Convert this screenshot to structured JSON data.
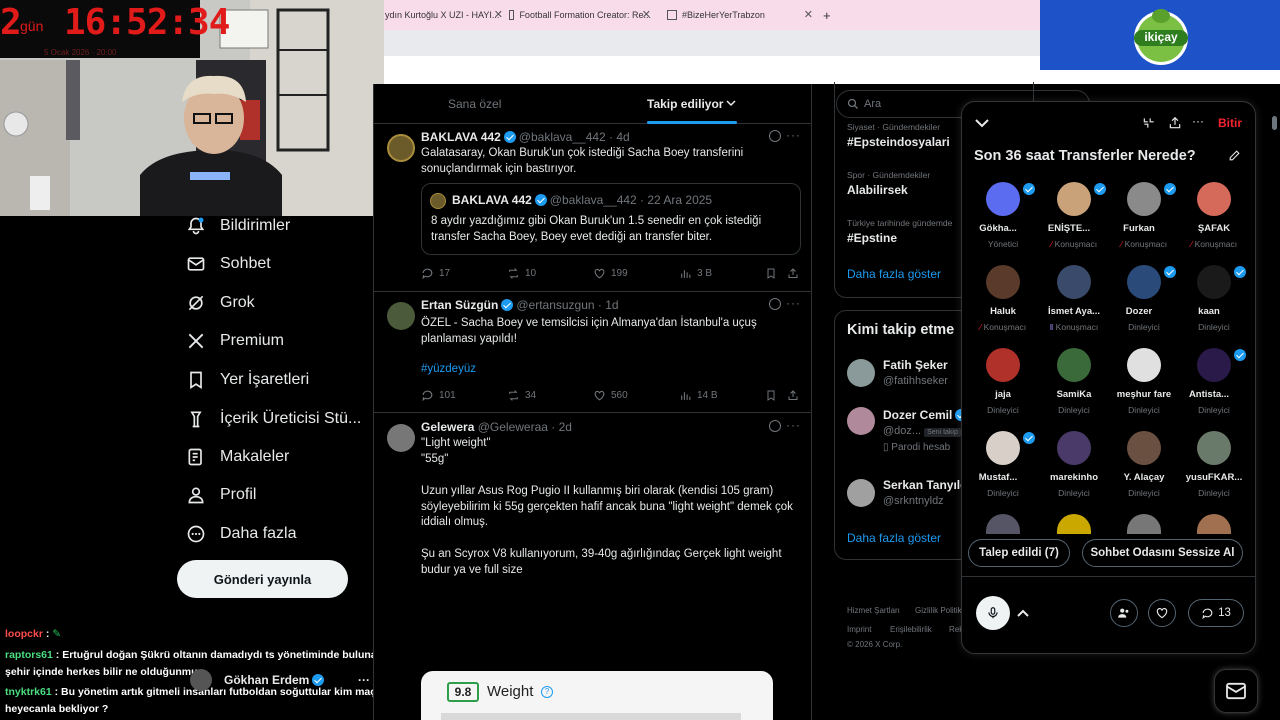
{
  "clock": {
    "days": "2",
    "days_label": "gün",
    "time": "16:52:34",
    "date": "5 Ocak 2026 · 20:00"
  },
  "browser": {
    "tabs": [
      {
        "title": "ydın Kurtoğlu X UZI - HAYI..."
      },
      {
        "title": "Football Formation Creator: Re..."
      },
      {
        "title": "#BizeHerYerTrabzon"
      }
    ],
    "new_tab": "+"
  },
  "logo": {
    "text": "ikiçay"
  },
  "nav": {
    "items": [
      {
        "label": "Bildirimler",
        "icon": "bell-icon"
      },
      {
        "label": "Sohbet",
        "icon": "mail-icon"
      },
      {
        "label": "Grok",
        "icon": "grok-icon"
      },
      {
        "label": "Premium",
        "icon": "x-logo-icon"
      },
      {
        "label": "Yer İşaretleri",
        "icon": "bookmark-icon"
      },
      {
        "label": "İçerik Üreticisi Stü...",
        "icon": "creator-icon"
      },
      {
        "label": "Makaleler",
        "icon": "article-icon"
      },
      {
        "label": "Profil",
        "icon": "profile-icon"
      },
      {
        "label": "Daha fazla",
        "icon": "more-icon"
      }
    ],
    "post_button": "Gönderi yayınla"
  },
  "chat": {
    "lines": [
      {
        "user": "loopckr",
        "user_color": "#ff4d4d",
        "text": ":"
      },
      {
        "user": "raptors61",
        "user_color": "#4ade80",
        "text": ": Ertuğrul doğan Şükrü oltanın damadıydı ts yönetiminde bulunana kadar"
      },
      {
        "user": "",
        "user_color": "#ffffff",
        "text": "şehir içinde herkes bilir ne olduğunmu"
      },
      {
        "user": "tnyktrk61",
        "user_color": "#4ade80",
        "text": ": Bu yönetim artık gitmeli insanları futboldan soğuttular kim maçı"
      },
      {
        "user": "",
        "user_color": "#ffffff",
        "text": "heyecanla bekliyor ?"
      }
    ],
    "account_chip": {
      "name": "Gökhan Erdem"
    }
  },
  "timeline": {
    "tabs": [
      {
        "label": "Sana özel"
      },
      {
        "label": "Takip ediliyor"
      }
    ],
    "tweets": [
      {
        "name": "BAKLAVA 442",
        "handle": "@baklava__442 · 4d",
        "text": "Galatasaray, Okan Buruk'un çok istediği Sacha Boey transferini sonuçlandırmak için bastırıyor.",
        "quote": {
          "name": "BAKLAVA 442",
          "handle": "@baklava__442 · 22 Ara 2025",
          "text": "8 aydır yazdığımız gibi Okan Buruk'un 1.5 senedir en çok istediği transfer Sacha Boey, Boey evet dediği an transfer biter."
        },
        "replies": "17",
        "reposts": "10",
        "likes": "199",
        "views": "3 B"
      },
      {
        "name": "Ertan Süzgün",
        "handle": "@ertansuzgun · 1d",
        "text": "ÖZEL - Sacha Boey ve temsilcisi için Almanya'dan İstanbul'a uçuş planlaması yapıldı!",
        "hashtag": "#yüzdeyüz",
        "replies": "101",
        "reposts": "34",
        "likes": "560",
        "views": "14 B"
      },
      {
        "name": "Gelewera",
        "handle": "@Geleweraa · 2d",
        "lines": [
          "\"Light weight\"",
          "\"55g\"",
          "Uzun yıllar Asus Rog Pugio II kullanmış biri olarak (kendisi 105 gram) söyleyebilirim ki 55g gerçekten hafif ancak buna \"light weight\" demek çok iddialı olmuş.",
          "Şu an Scyrox V8 kullanıyorum, 39-40g ağırlığındaç Gerçek light weight budur ya ve full size"
        ],
        "media": {
          "score": "9.8",
          "label": "Weight"
        }
      }
    ]
  },
  "right": {
    "search_placeholder": "Ara",
    "trends": [
      {
        "category": "Siyaset · Gündemdekiler",
        "name": "#Epsteindosyalari"
      },
      {
        "category": "Spor · Gündemdekiler",
        "name": "Alabilirsek"
      },
      {
        "category": "Türkiye tarihinde gündemde",
        "name": "#Epstine"
      }
    ],
    "trends_more": "Daha fazla göster",
    "who_to_follow_title": "Kimi takip etme",
    "follow": [
      {
        "name": "Fatih Şeker",
        "handle": "@fatihhseker"
      },
      {
        "name": "Dozer Cemil",
        "handle": "@doz...",
        "badge": "Seni takip",
        "note": "Parodi hesab"
      },
      {
        "name": "Serkan Tanyıld",
        "handle": "@srkntnyldz"
      }
    ],
    "follow_more": "Daha fazla göster",
    "footer": {
      "row1": [
        "Hizmet Şartları",
        "Gizlilik Politik"
      ],
      "row2": [
        "Imprint",
        "Erişilebilirlik",
        "Rek"
      ],
      "copyright": "© 2026 X Corp."
    }
  },
  "spaces": {
    "title": "Son 36 saat Transferler Nerede?",
    "end_label": "Bitir",
    "people": [
      {
        "name": "Gökha...",
        "role": "Yönetici",
        "color": "#5b6cf0",
        "verified": true
      },
      {
        "name": "ENİŞTE...",
        "role": "Konuşmacı",
        "color": "#c9a27a",
        "verified": true,
        "muted": true
      },
      {
        "name": "Furkan",
        "role": "Konuşmacı",
        "color": "#8a8a8a",
        "verified": true,
        "muted": true
      },
      {
        "name": "ŞAFAK",
        "role": "Konuşmacı",
        "color": "#d66a5a",
        "muted": true
      },
      {
        "name": "Haluk",
        "role": "Konuşmacı",
        "color": "#5a3a2a",
        "muted": true
      },
      {
        "name": "İsmet Aya...",
        "role": "Konuşmacı",
        "color": "#3a4a6a",
        "speaking": true
      },
      {
        "name": "Dozer",
        "role": "Dinleyici",
        "color": "#2a4a7a",
        "verified": true
      },
      {
        "name": "kaan",
        "role": "Dinleyici",
        "color": "#1a1a1a",
        "verified": true
      },
      {
        "name": "jaja",
        "role": "Dinleyici",
        "color": "#b0302a"
      },
      {
        "name": "SamiKa",
        "role": "Dinleyici",
        "color": "#3a6a3a"
      },
      {
        "name": "meşhur fare",
        "role": "Dinleyici",
        "color": "#e0e0e0"
      },
      {
        "name": "Antista...",
        "role": "Dinleyici",
        "color": "#2a1a4a",
        "verified": true
      },
      {
        "name": "Mustaf...",
        "role": "Dinleyici",
        "color": "#d8d0c8",
        "verified": true
      },
      {
        "name": "marekinho",
        "role": "Dinleyici",
        "color": "#4a3a6a"
      },
      {
        "name": "Y. Alaçay",
        "role": "Dinleyici",
        "color": "#6a5040"
      },
      {
        "name": "yusuFKAR...",
        "role": "Dinleyici",
        "color": "#6a7a6a"
      }
    ],
    "requests_button": "Talep edildi (7)",
    "mute_button": "Sohbet Odasını Sessize Al",
    "reply_count": "13"
  },
  "colors": {
    "accent": "#1d9bf0",
    "end": "#f4212e",
    "clock": "#e11a1a"
  }
}
